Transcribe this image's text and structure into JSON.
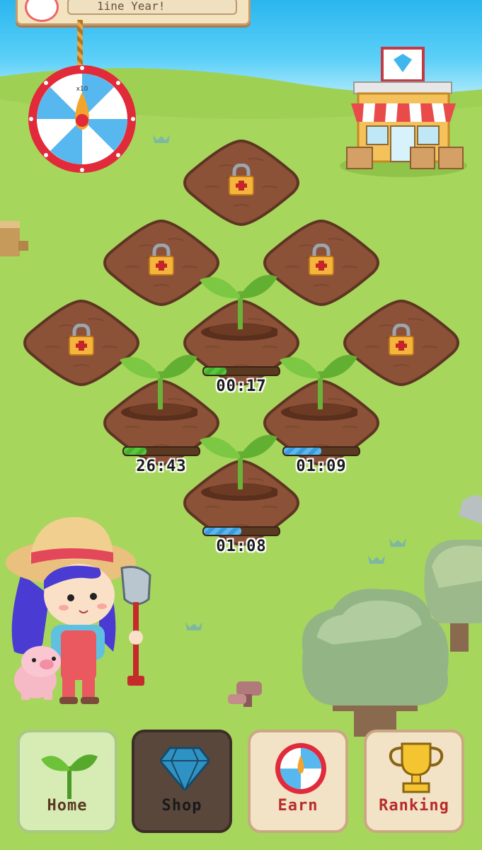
{
  "top_banner": {
    "text": "1ine Year!"
  },
  "spin_wheel": {
    "badge": "x10"
  },
  "plots": [
    {
      "id": "top",
      "state": "locked"
    },
    {
      "id": "upper-left",
      "state": "locked"
    },
    {
      "id": "upper-right",
      "state": "locked"
    },
    {
      "id": "left",
      "state": "locked"
    },
    {
      "id": "center",
      "state": "growing",
      "timer": "00:17",
      "progress": 0.3,
      "bar_color": "green"
    },
    {
      "id": "right",
      "state": "locked"
    },
    {
      "id": "lower-left",
      "state": "growing",
      "timer": "26:43",
      "progress": 0.3,
      "bar_color": "green"
    },
    {
      "id": "lower-right",
      "state": "growing",
      "timer": "01:09",
      "progress": 0.5,
      "bar_color": "blue"
    },
    {
      "id": "bottom",
      "state": "growing",
      "timer": "01:08",
      "progress": 0.5,
      "bar_color": "blue"
    }
  ],
  "nav": {
    "home": "Home",
    "shop": "Shop",
    "earn": "Earn",
    "ranking": "Ranking"
  },
  "colors": {
    "sky": "#2ab6ee",
    "grass": "#9ed054",
    "soil": "#8c5238",
    "soil_border": "#5e3423",
    "lock_gold": "#f5b53c"
  },
  "icons": [
    "spin-wheel-icon",
    "store-icon",
    "lock-icon",
    "sprout-icon",
    "diamond-icon",
    "trophy-icon"
  ]
}
